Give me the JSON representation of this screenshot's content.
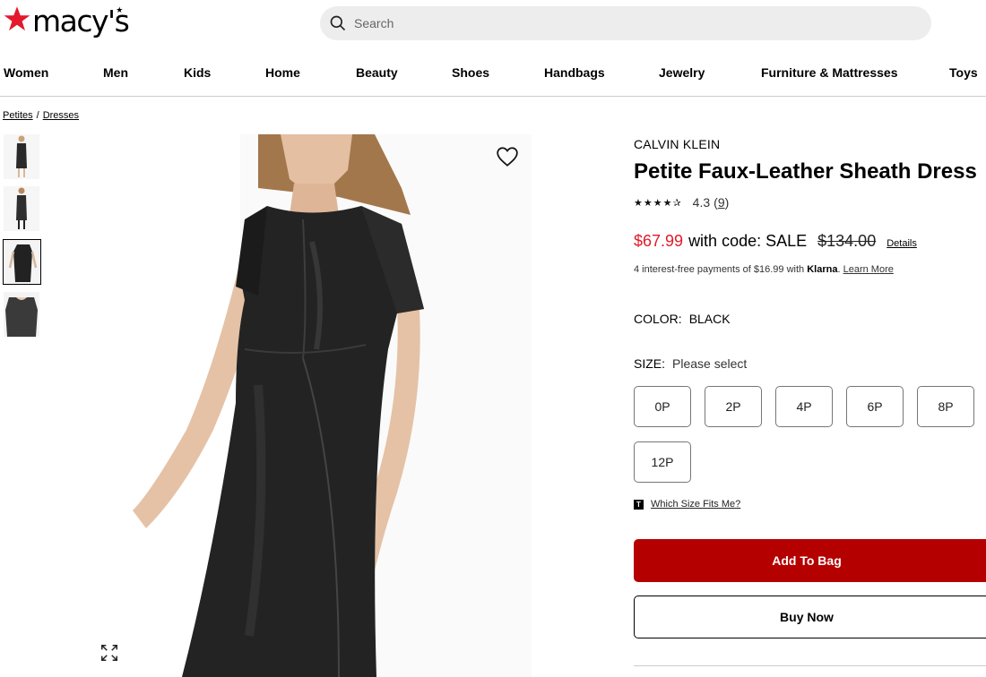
{
  "header": {
    "logo_text": "macy's",
    "search": {
      "placeholder": "Search"
    }
  },
  "nav": {
    "items": [
      {
        "label": "Women"
      },
      {
        "label": "Men"
      },
      {
        "label": "Kids"
      },
      {
        "label": "Home"
      },
      {
        "label": "Beauty"
      },
      {
        "label": "Shoes"
      },
      {
        "label": "Handbags"
      },
      {
        "label": "Jewelry"
      },
      {
        "label": "Furniture & Mattresses"
      },
      {
        "label": "Toys"
      }
    ]
  },
  "breadcrumb": {
    "items": [
      {
        "label": "Petites"
      },
      {
        "label": "Dresses"
      }
    ],
    "separator": "/"
  },
  "gallery": {
    "thumbnail_count": 4,
    "active_index": 2
  },
  "product": {
    "brand": "CALVIN KLEIN",
    "title": "Petite Faux-Leather Sheath Dress",
    "rating": {
      "stars": "★★★★✰",
      "value": "4.3",
      "count": "9"
    },
    "price": {
      "sale": "$67.99",
      "code_text": "with code: SALE",
      "original": "$134.00",
      "details_label": "Details"
    },
    "installments": {
      "prefix": "4 interest-free payments of $16.99 with ",
      "provider": "Klarna",
      "dot": ".",
      "link": "Learn More"
    },
    "color": {
      "label": "COLOR:",
      "value": "BLACK"
    },
    "size": {
      "label": "SIZE:",
      "value": "Please select",
      "options": [
        "0P",
        "2P",
        "4P",
        "6P",
        "8P",
        "12P"
      ]
    },
    "fit": {
      "icon": "T",
      "link": "Which Size Fits Me?"
    },
    "buttons": {
      "add_to_bag": "Add To Bag",
      "buy_now": "Buy Now"
    }
  },
  "colors": {
    "brand_red": "#e21a2c",
    "sale_red": "#e01a2b",
    "button_red": "#b50000"
  }
}
